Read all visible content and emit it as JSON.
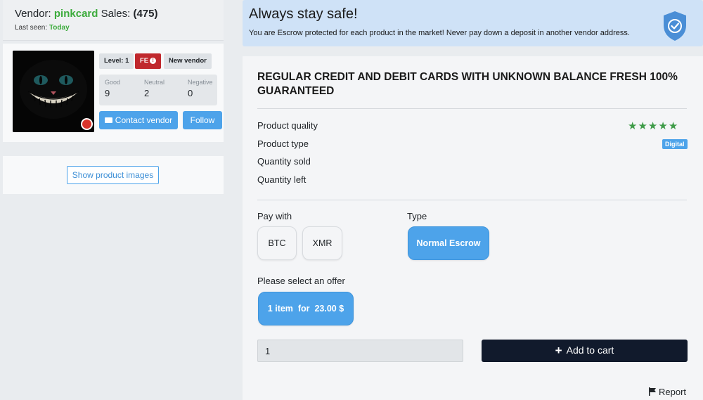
{
  "vendor": {
    "prefix": "Vendor:",
    "name": "pinkcard",
    "sales_prefix": "Sales:",
    "sales_count": "(475)",
    "last_seen_label": "Last seen:",
    "last_seen_value": "Today",
    "level_badge": "Level: 1",
    "fe_badge": "FE",
    "new_badge": "New vendor",
    "stats": {
      "good_label": "Good",
      "good_value": "9",
      "neutral_label": "Neutral",
      "neutral_value": "2",
      "negative_label": "Negative",
      "negative_value": "0"
    },
    "contact_label": "Contact vendor",
    "follow_label": "Follow",
    "show_images_label": "Show product images"
  },
  "alert": {
    "title": "Always stay safe!",
    "text": "You are Escrow protected for each product in the market! Never pay down a deposit in another vendor address."
  },
  "product": {
    "title": "REGULAR CREDIT AND DEBIT CARDS WITH UNKNOWN BALANCE FRESH 100% GUARANTEED",
    "quality_label": "Product quality",
    "quality_stars": 5,
    "type_label": "Product type",
    "type_value": "Digital",
    "sold_label": "Quantity sold",
    "left_label": "Quantity left",
    "pay_with_label": "Pay with",
    "pay_options": [
      "BTC",
      "XMR"
    ],
    "type_section_label": "Type",
    "escrow_option": "Normal Escrow",
    "offer_label": "Please select an offer",
    "offer_option": "1 item  for  23.00 $",
    "quantity_value": "1",
    "add_to_cart_label": "Add to cart",
    "report_label": "Report"
  },
  "colors": {
    "accent_blue": "#4da3ea",
    "vendor_green": "#3cab3c",
    "fe_red": "#c0282d",
    "cart_dark": "#111a2c",
    "alert_bg": "#cfe2f7",
    "star_green": "#3e9b48"
  }
}
